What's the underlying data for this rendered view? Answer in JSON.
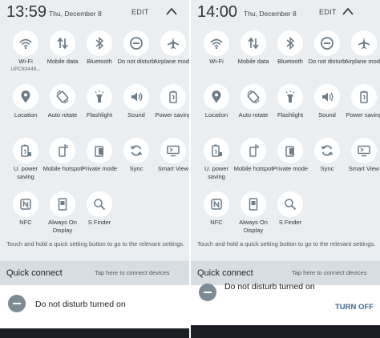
{
  "colors": {
    "panel_bg": "#eaeef1",
    "tile_bg": "#ffffff",
    "icon": "#6d7c87",
    "text": "#333333",
    "link": "#3e6a92",
    "quick_connect_bg": "#d7dee3"
  },
  "left": {
    "clock": "13:59",
    "date": "Thu, December 8",
    "edit_label": "EDIT",
    "tiles": [
      {
        "label": "Wi-Fi",
        "sub": "UPC83449...",
        "icon": "wifi-icon"
      },
      {
        "label": "Mobile data",
        "icon": "mobile-data-icon"
      },
      {
        "label": "Bluetooth",
        "icon": "bluetooth-icon"
      },
      {
        "label": "Do not disturb",
        "icon": "do-not-disturb-icon"
      },
      {
        "label": "Airplane mode",
        "icon": "airplane-icon"
      },
      {
        "label": "Location",
        "icon": "location-icon"
      },
      {
        "label": "Auto rotate",
        "icon": "rotate-icon"
      },
      {
        "label": "Flashlight",
        "icon": "flashlight-icon"
      },
      {
        "label": "Sound",
        "icon": "sound-icon"
      },
      {
        "label": "Power saving",
        "icon": "power-saving-icon"
      },
      {
        "label": "U. power saving",
        "icon": "ultra-power-saving-icon"
      },
      {
        "label": "Mobile hotspot",
        "icon": "hotspot-icon"
      },
      {
        "label": "Private mode",
        "icon": "private-mode-icon"
      },
      {
        "label": "Sync",
        "icon": "sync-icon"
      },
      {
        "label": "Smart View",
        "icon": "smart-view-icon"
      },
      {
        "label": "NFC",
        "icon": "nfc-icon"
      },
      {
        "label": "Always On Display",
        "icon": "always-on-display-icon"
      },
      {
        "label": "S Finder",
        "icon": "s-finder-icon"
      }
    ],
    "hint": "Touch and hold a quick setting button to go to the relevant settings.",
    "quick_connect_title": "Quick connect",
    "quick_connect_sub": "Tap here to connect devices",
    "notification": "Do not disturb turned on"
  },
  "right": {
    "clock": "14:00",
    "date": "Thu, December 8",
    "edit_label": "EDIT",
    "tiles": [
      {
        "label": "Wi-Fi",
        "icon": "wifi-icon"
      },
      {
        "label": "Mobile data",
        "icon": "mobile-data-icon"
      },
      {
        "label": "Bluetooth",
        "icon": "bluetooth-icon"
      },
      {
        "label": "Do not disturb",
        "icon": "do-not-disturb-icon"
      },
      {
        "label": "Airplane mode",
        "icon": "airplane-icon"
      },
      {
        "label": "Location",
        "icon": "location-icon"
      },
      {
        "label": "Auto rotate",
        "icon": "rotate-icon"
      },
      {
        "label": "Flashlight",
        "icon": "flashlight-icon"
      },
      {
        "label": "Sound",
        "icon": "sound-icon"
      },
      {
        "label": "Power saving",
        "icon": "power-saving-icon"
      },
      {
        "label": "U. power saving",
        "icon": "ultra-power-saving-icon"
      },
      {
        "label": "Mobile hotspot",
        "icon": "hotspot-icon"
      },
      {
        "label": "Private mode",
        "icon": "private-mode-icon"
      },
      {
        "label": "Sync",
        "icon": "sync-icon"
      },
      {
        "label": "Smart View",
        "icon": "smart-view-icon"
      },
      {
        "label": "NFC",
        "icon": "nfc-icon"
      },
      {
        "label": "Always On Display",
        "icon": "always-on-display-icon"
      },
      {
        "label": "S Finder",
        "icon": "s-finder-icon"
      }
    ],
    "hint": "Touch and hold a quick setting button to go to the relevant settings.",
    "quick_connect_title": "Quick connect",
    "quick_connect_sub": "Tap here to connect devices",
    "notification": "Do not disturb turned on",
    "turn_off_label": "TURN OFF"
  }
}
